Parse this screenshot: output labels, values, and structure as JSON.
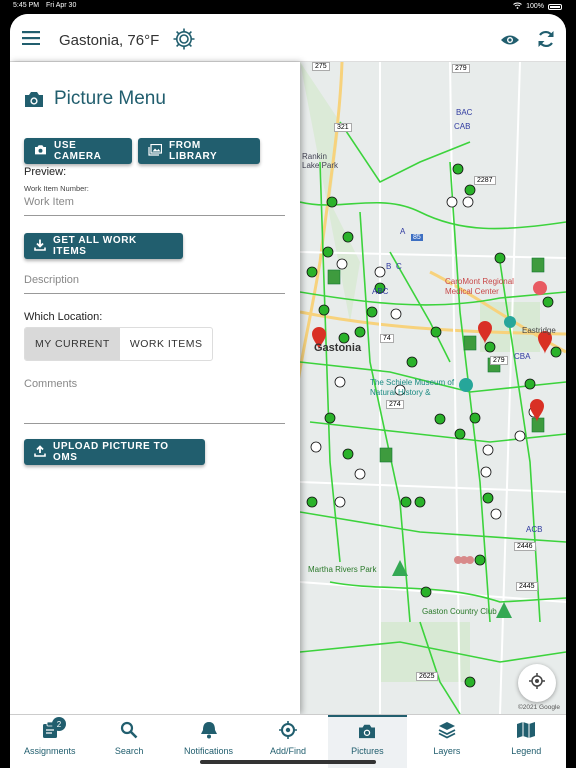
{
  "status": {
    "time": "5:45 PM",
    "date": "Fri Apr 30",
    "battery": "100%"
  },
  "header": {
    "location": "Gastonia,",
    "temperature": "76°F"
  },
  "panel": {
    "title": "Picture Menu",
    "use_camera": "USE CAMERA",
    "from_library": "FROM LIBRARY",
    "preview_label": "Preview:",
    "work_item_number_label": "Work Item Number:",
    "work_item_placeholder": "Work Item",
    "get_all_work_items": "GET ALL WORK ITEMS",
    "description_placeholder": "Description",
    "which_location_label": "Which Location:",
    "location_options": [
      "MY CURRENT",
      "WORK ITEMS"
    ],
    "comments_placeholder": "Comments",
    "upload": "UPLOAD PICTURE TO OMS"
  },
  "map": {
    "labels": [
      "Rankin Lake Park",
      "Gastonia",
      "CaroMont Regional Medical Center",
      "Eastridge",
      "The Schiele Museum of Natural History &",
      "Martha Rivers Park",
      "Gaston Country Club"
    ],
    "road_numbers": [
      "275",
      "279",
      "321",
      "2287",
      "85",
      "74",
      "274",
      "279",
      "2446",
      "2445",
      "2625"
    ],
    "codes": [
      "CAB",
      "BAC",
      "CBA",
      "ABC",
      "ACB",
      "B",
      "C",
      "A"
    ],
    "copyright": "©2021 Google"
  },
  "tabs": [
    {
      "label": "Assignments",
      "icon": "clipboard-icon",
      "badge": "2"
    },
    {
      "label": "Search",
      "icon": "search-icon"
    },
    {
      "label": "Notifications",
      "icon": "bell-icon"
    },
    {
      "label": "Add/Find",
      "icon": "crosshair-icon"
    },
    {
      "label": "Pictures",
      "icon": "camera-icon",
      "active": true
    },
    {
      "label": "Layers",
      "icon": "layers-icon"
    },
    {
      "label": "Legend",
      "icon": "legend-icon"
    }
  ],
  "colors": {
    "accent": "#215e6e",
    "network": "#3cd33c",
    "marker": "#d93025"
  }
}
